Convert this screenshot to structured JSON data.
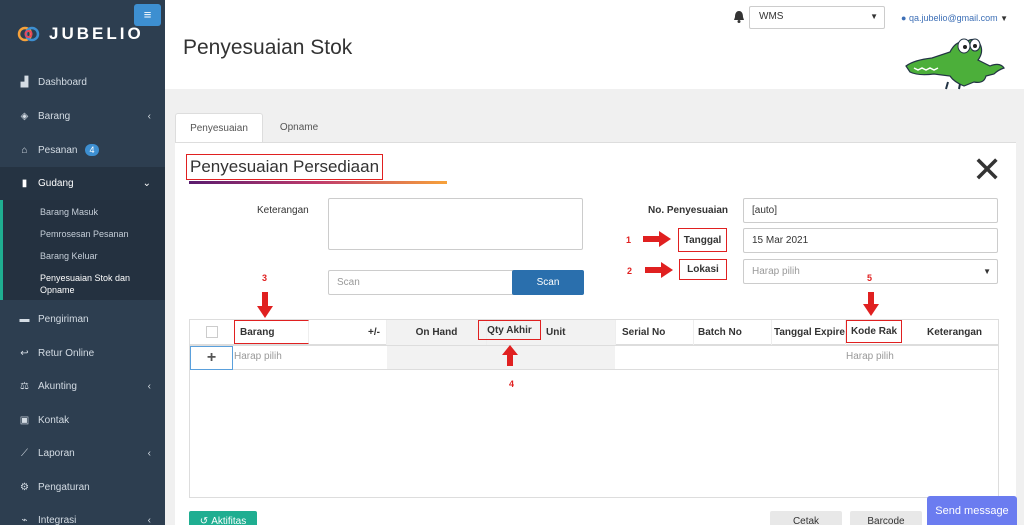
{
  "app": {
    "name": "JUBELIO"
  },
  "sidebar": {
    "items": [
      {
        "label": "Dashboard",
        "icon": "dashboard-icon"
      },
      {
        "label": "Barang",
        "icon": "cubes-icon"
      },
      {
        "label": "Pesanan",
        "icon": "basket-icon",
        "badge": "4"
      },
      {
        "label": "Gudang",
        "icon": "warehouse-icon"
      },
      {
        "label": "Pengiriman",
        "icon": "truck-icon"
      },
      {
        "label": "Retur Online",
        "icon": "reply-icon"
      },
      {
        "label": "Akunting",
        "icon": "scale-icon"
      },
      {
        "label": "Kontak",
        "icon": "address-book-icon"
      },
      {
        "label": "Laporan",
        "icon": "chart-icon"
      },
      {
        "label": "Pengaturan",
        "icon": "cogs-icon"
      },
      {
        "label": "Integrasi",
        "icon": "plug-icon"
      }
    ],
    "submenu": [
      "Barang Masuk",
      "Pemrosesan Pesanan",
      "Barang Keluar",
      "Penyesuaian Stok dan",
      "Opname"
    ]
  },
  "header": {
    "title": "Penyesuaian Stok",
    "warehouse": "WMS",
    "user": "qa.jubelio@gmail.com"
  },
  "tabs": [
    "Penyesuaian",
    "Opname"
  ],
  "form": {
    "title": "Penyesuaian Persediaan",
    "keterangan_label": "Keterangan",
    "scan_placeholder": "Scan",
    "scan_button": "Scan",
    "no_label": "No. Penyesuaian",
    "no_value": "[auto]",
    "tanggal_label": "Tanggal",
    "tanggal_value": "15 Mar 2021",
    "lokasi_label": "Lokasi",
    "lokasi_placeholder": "Harap pilih"
  },
  "annotations": [
    "1",
    "2",
    "3",
    "4",
    "5"
  ],
  "table": {
    "headers": [
      "Barang",
      "+/-",
      "On Hand",
      "Qty Akhir",
      "Unit",
      "Serial No",
      "Batch No",
      "Tanggal Expired",
      "Kode Rak",
      "Keterangan"
    ],
    "row": {
      "add": "+",
      "barang": "Harap pilih",
      "kode_rak": "Harap pilih"
    }
  },
  "footer": {
    "aktifitas": "Aktifitas",
    "cetak": "Cetak",
    "barcode": "Barcode",
    "send_message": "Send message"
  },
  "colors": {
    "sidebar": "#2d3e50",
    "accent": "#3d8fd1",
    "annotation": "#e02020",
    "scan_button": "#2a6fad",
    "aktifitas": "#1fae91",
    "send_message": "#6b7cf0"
  }
}
